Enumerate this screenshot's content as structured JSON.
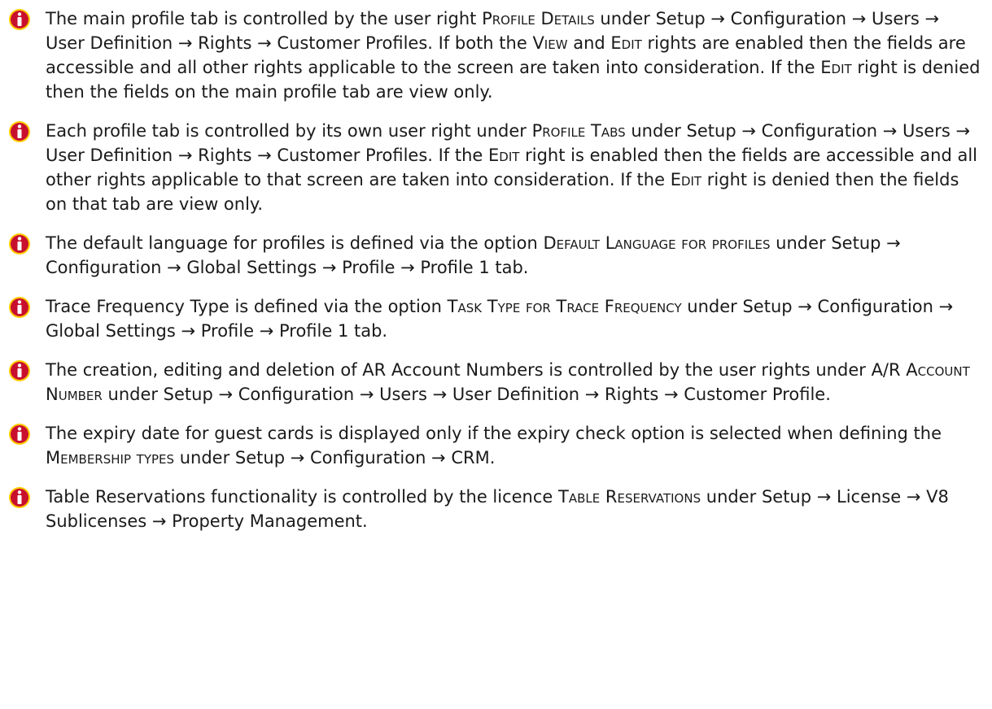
{
  "accent_color": "#c8102e",
  "icon_glow_color": "#ffcc00",
  "notes": [
    {
      "icon": "info-icon",
      "parts": [
        "The main profile tab is controlled by the user right ",
        "Profile Details",
        " under Setup → Configuration → Users → User Definition → Rights → Customer Profiles. If both the ",
        "View",
        " and ",
        "Edit",
        " rights are enabled then the fields are accessible and all other rights applicable to the screen are taken into consideration. If the ",
        "Edit",
        " right is denied then the fields on the main profile tab are view only."
      ]
    },
    {
      "icon": "info-icon",
      "parts": [
        "Each profile tab is controlled by its own user right under ",
        "Profile Tabs",
        " under Setup → Configuration → Users → User Definition → Rights → Customer Profiles. If the ",
        "Edit",
        " right is enabled then the fields are accessible and all other rights applicable to that screen are taken into consideration. If the ",
        "Edit",
        " right is denied then the fields on that tab are view only."
      ]
    },
    {
      "icon": "info-icon",
      "parts": [
        "The default language for profiles is defined via the option ",
        "Default Language for profiles",
        " under Setup → Configuration → Global Settings → Profile → Profile 1 tab."
      ]
    },
    {
      "icon": "info-icon",
      "parts": [
        "Trace Frequency Type is defined via the option ",
        "Task Type for Trace Frequency",
        " under Setup → Configuration → Global Settings → Profile → Profile 1 tab."
      ]
    },
    {
      "icon": "info-icon",
      "parts": [
        "The creation, editing and deletion of AR Account Numbers is controlled by the user rights under ",
        "A/R Account Number",
        " under Setup → Configuration → Users → User Definition → Rights → Customer Profile."
      ]
    },
    {
      "icon": "info-icon",
      "parts": [
        "The expiry date for guest cards is displayed only if the expiry check option is selected when defining the ",
        "Membership types",
        " under Setup → Configuration → CRM."
      ]
    },
    {
      "icon": "info-icon",
      "parts": [
        "Table Reservations functionality is controlled by the licence ",
        "Table Reservations",
        " under Setup → License → V8 Sublicenses → Property Management."
      ]
    }
  ]
}
